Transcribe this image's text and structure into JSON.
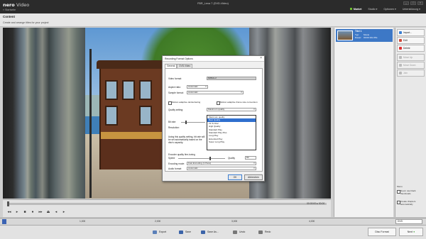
{
  "app": {
    "logo_bold": "nero",
    "logo_light": "Video",
    "back_label": "« Startseite",
    "doc_title": "FBR_Lena 7 (DVD-Video)",
    "window_buttons": [
      "_",
      "□",
      "×"
    ],
    "menu": [
      "Market",
      "Studio ▾",
      "Optionen ▾",
      "Unterstützung ▾"
    ]
  },
  "subheader": {
    "title": "Content",
    "subtitle": "Create and arrange titles for your project"
  },
  "player": {
    "time": "00:00:00 ▸ 00:00",
    "controls": [
      "◂◂",
      "▸",
      "■",
      "●",
      "▸▸",
      "⏏",
      "◂",
      "▸"
    ]
  },
  "title_item": {
    "name": "Titel 1",
    "type_label": "Typ:",
    "type_value": "Movie",
    "duration_label": "Dauer:",
    "duration_value": "00:00:10s 05s"
  },
  "actions": {
    "buttons": [
      {
        "label": "Import...",
        "color": "#3c7fd1",
        "disabled": false
      },
      {
        "label": "Edit",
        "color": "#d04a3a",
        "disabled": false
      },
      {
        "label": "Delete",
        "color": "#d33",
        "disabled": false
      },
      {
        "label": "Move Up",
        "color": "#aaa",
        "disabled": true
      },
      {
        "label": "Move Down",
        "color": "#aaa",
        "disabled": true
      },
      {
        "label": "Join",
        "color": "#aaa",
        "disabled": true
      }
    ],
    "menu_label": "Menu",
    "checkbox_1": "Never use black thumbnails",
    "checkbox_2": "Create chapters automatically"
  },
  "ruler": {
    "labels": [
      "1,000",
      "2,000",
      "3,000",
      "4,000"
    ],
    "format": "DVD"
  },
  "toolbar": {
    "export": "Export",
    "save": "Save",
    "save_as": "Save As...",
    "undo": "Undo",
    "redo": "Redo",
    "disc_format": "Disc Format",
    "next": "Next"
  },
  "dialog": {
    "title": "Recording Format Options",
    "close": "×",
    "tabs": [
      "General",
      "DVD-Video"
    ],
    "video_format_label": "Video format:",
    "video_format_value": "MPEG-2",
    "aspect_label": "Aspect ratio:",
    "aspect_value": "Automatic",
    "sample_label": "Sample format:",
    "sample_value": "Automatic",
    "cb_deinterlacing": "Motion adaptive deinterlacing",
    "cb_framerate": "Motion adaptive frame rate conversion",
    "quality_label": "Quality setting:",
    "quality_value": "Maximum quality",
    "quality_options": [
      "Maximum quality",
      "Best Quality",
      "Fit To Disc",
      "High Quality",
      "Standard Play",
      "Standard Play Plus",
      "Long Play",
      "Extended Play",
      "Super Long Play"
    ],
    "quality_selected_index": 1,
    "bitrate_label": "Bit rate:",
    "resolution_label": "Resolution:",
    "info_text": "Using this quality setting, bit rate will be set automatically based on the disc's capacity.",
    "encoder_label": "Encoder quality fine-tuning",
    "speed_label": "Speed",
    "quality_word": "Quality",
    "quality_num": "80",
    "mode_label": "Encoding mode:",
    "mode_value": "Fast Encoding (1 Pass)",
    "audio_label": "Audio format:",
    "audio_value": "Automatic",
    "ok": "OK",
    "cancel": "Abbrechen"
  }
}
